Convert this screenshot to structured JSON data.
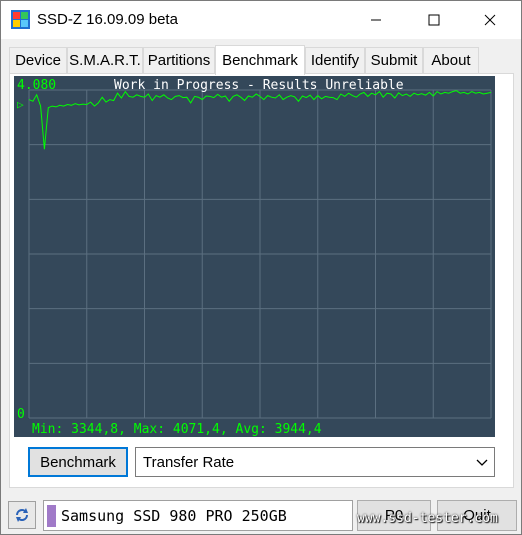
{
  "window": {
    "title": "SSD-Z 16.09.09 beta"
  },
  "tabs": [
    {
      "label": "Device"
    },
    {
      "label": "S.M.A.R.T."
    },
    {
      "label": "Partitions"
    },
    {
      "label": "Benchmark"
    },
    {
      "label": "Identify"
    },
    {
      "label": "Submit"
    },
    {
      "label": "About"
    }
  ],
  "active_tab": "Benchmark",
  "chart": {
    "top_value": "4.080",
    "status": "Work in Progress - Results Unreliable",
    "zero_label": "0",
    "marker": "▷",
    "stats": "Min: 3344,8, Max: 4071,4, Avg: 3944,4",
    "colors": {
      "background": "#34485a",
      "grid": "#5b6f80",
      "line": "#00ff00",
      "text": "#00ff00",
      "title": "#ffffff"
    }
  },
  "chart_data": {
    "type": "line",
    "title": "Work in Progress - Results Unreliable",
    "ylim": [
      0,
      4080
    ],
    "x": [
      0,
      1,
      2,
      3,
      4,
      5,
      6,
      7,
      8,
      9,
      10,
      11,
      12,
      13,
      14,
      15,
      16,
      17,
      18,
      19,
      20,
      21,
      22,
      23,
      24,
      25,
      26,
      27,
      28,
      29,
      30,
      31,
      32,
      33,
      34,
      35,
      36,
      37,
      38,
      39,
      40,
      41,
      42,
      43,
      44,
      45,
      46,
      47,
      48,
      49,
      50,
      51,
      52,
      53,
      54,
      55,
      56,
      57,
      58,
      59,
      60,
      61,
      62,
      63,
      64,
      65,
      66,
      67,
      68,
      69,
      70,
      71,
      72,
      73,
      74,
      75,
      76,
      77,
      78,
      79,
      80,
      81,
      82,
      83,
      84,
      85,
      86,
      87,
      88,
      89,
      90,
      91,
      92,
      93,
      94,
      95,
      96,
      97,
      98,
      99,
      100,
      101,
      102,
      103,
      104,
      105,
      106,
      107,
      108,
      109,
      110,
      111,
      112,
      113,
      114,
      115,
      116,
      117,
      118,
      119,
      120
    ],
    "series": [
      {
        "values": [
          3960,
          3940,
          4020,
          3880,
          3344,
          3860,
          3880,
          3870,
          3890,
          3880,
          3900,
          3890,
          3910,
          3895,
          3905,
          3900,
          3930,
          3880,
          3920,
          3990,
          3930,
          3960,
          3950,
          4040,
          3980,
          4060,
          4000,
          3990,
          4020,
          4000,
          3990,
          4030,
          3950,
          4010,
          3990,
          4020,
          3980,
          3960,
          4000,
          4010,
          3985,
          3990,
          3920,
          4000,
          3990,
          3960,
          4005,
          4000,
          3985,
          4025,
          3990,
          4005,
          3940,
          4000,
          4020,
          3990,
          3950,
          4005,
          3990,
          4030,
          4000,
          3960,
          4010,
          3990,
          3980,
          4020,
          3960,
          3990,
          4010,
          3995,
          3940,
          4005,
          3985,
          4015,
          3960,
          4010,
          3970,
          4000,
          3990,
          3985,
          3960,
          4030,
          4000,
          4040,
          4010,
          3990,
          4030,
          4050,
          4000,
          4040,
          4020,
          4060,
          3990,
          4040,
          4030,
          3980,
          4045,
          4010,
          4030,
          4000,
          4040,
          4020,
          4035,
          4015,
          4050,
          4005,
          4060,
          4030,
          4050,
          4040,
          4060,
          4071,
          4040,
          4050,
          4030,
          4060,
          4040,
          4050,
          4030,
          4040,
          4050
        ]
      }
    ],
    "stats": {
      "min": 3344.8,
      "max": 4071.4,
      "avg": 3944.4
    }
  },
  "controls": {
    "benchmark_button": "Benchmark",
    "mode_select": "Transfer Rate"
  },
  "status_bar": {
    "drive_name": "Samsung SSD 980 PRO 250GB",
    "p0_button": "P0",
    "quit_button": "Quit",
    "watermark": "www.ssd-tester.com"
  }
}
